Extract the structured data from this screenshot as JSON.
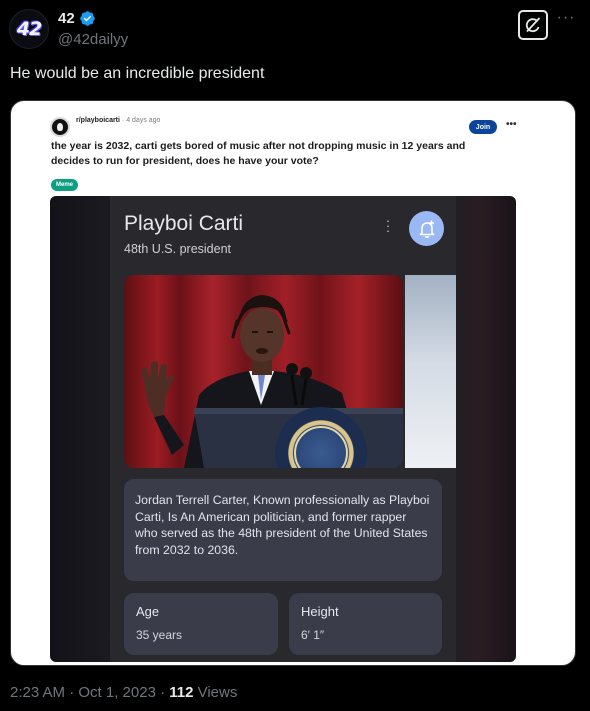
{
  "tweet": {
    "avatar_text": "42",
    "display_name": "42",
    "handle": "@42dailyy",
    "text": "He would be an incredible president",
    "timestamp": "2:23 AM · Oct 1, 2023 · ",
    "views_count": "112",
    "views_label": " Views"
  },
  "reddit_post": {
    "subreddit": "r/playboicarti",
    "separator": " · ",
    "time": "4 days ago",
    "join_label": "Join",
    "more_label": "•••",
    "title": "the year is 2032, carti gets bored of music after not dropping music in 12 years and decides to run for president, does he have your vote?",
    "flair": "Meme"
  },
  "knowledge_panel": {
    "title": "Playboi Carti",
    "subtitle": "48th U.S. president",
    "description": "Jordan Terrell Carter, Known professionally as Playboi Carti, Is An American politician, and former rapper who served as the 48th president of the United States from 2032 to 2036.",
    "facts": [
      {
        "label": "Age",
        "value": "35 years"
      },
      {
        "label": "Height",
        "value": "6′ 1″"
      }
    ]
  },
  "colors": {
    "background": "#000000",
    "verified_blue": "#1d9bf0",
    "secondary_text": "#71767b",
    "reddit_join": "#0a449b",
    "flair_green": "#0d9e84",
    "panel_card": "#3a3c4a",
    "fab_blue": "#9ab8f3"
  },
  "icons": [
    "verified-badge-icon",
    "grok-icon",
    "more-icon",
    "bell-plus-icon",
    "kebab-menu-icon"
  ]
}
